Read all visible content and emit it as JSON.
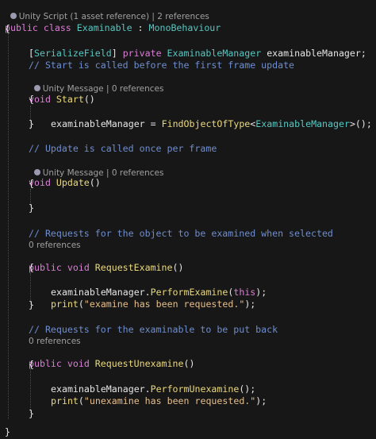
{
  "codelens": {
    "class_refs": "Unity Script (1 asset reference) | 2 references",
    "start_refs": "Unity Message | 0 references",
    "update_refs": "Unity Message | 0 references",
    "request_examine_refs": "0 references",
    "request_unexamine_refs": "0 references"
  },
  "code": {
    "kw_public": "public",
    "kw_class": "class",
    "class_name": "Examinable",
    "colon": " : ",
    "base_class": "MonoBehaviour",
    "open_brace": "{",
    "close_brace": "}",
    "attr_open": "[",
    "attr_name": "SerializeField",
    "attr_close": "]",
    "kw_private": "private",
    "field_type": "ExaminableManager",
    "field_name": "examinableManager;",
    "comment_start": "// Start is called before the first frame update",
    "kw_void": "void",
    "fn_start": "Start",
    "parens": "()",
    "assign_lhs": "examinableManager = ",
    "fn_find": "FindObjectOfType",
    "lt": "<",
    "generic_type": "ExaminableManager",
    "gt_call": ">();",
    "comment_update": "// Update is called once per frame",
    "fn_update": "Update",
    "comment_request_examine": "// Requests for the object to be examined when selected",
    "fn_request_examine": "RequestExamine",
    "call_obj": "examinableManager.",
    "fn_perform_examine": "PerformExamine",
    "paren_open": "(",
    "kw_this": "this",
    "paren_close_semi": ");",
    "fn_print": "print",
    "str_examine": "\"examine has been requested.\"",
    "comment_request_unexamine": "// Requests for the examinable to be put back",
    "fn_request_unexamine": "RequestUnexamine",
    "fn_perform_unexamine": "PerformUnexamine",
    "call_empty_semi": "();",
    "str_unexamine": "\"unexamine has been requested.\""
  }
}
